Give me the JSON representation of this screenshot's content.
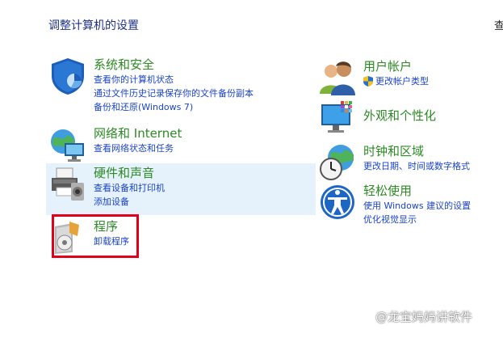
{
  "page": {
    "title": "调整计算机的设置",
    "view_by_label": "查"
  },
  "categories_left": [
    {
      "title": "系统和安全",
      "links": [
        "查看你的计算机状态",
        "通过文件历史记录保存你的文件备份副本",
        "备份和还原(Windows 7)"
      ]
    },
    {
      "title": "网络和 Internet",
      "links": [
        "查看网络状态和任务"
      ]
    },
    {
      "title": "硬件和声音",
      "links": [
        "查看设备和打印机",
        "添加设备"
      ]
    },
    {
      "title": "程序",
      "links": [
        "卸载程序"
      ]
    }
  ],
  "categories_right": [
    {
      "title": "用户帐户",
      "links": [
        "更改帐户类型"
      ]
    },
    {
      "title": "外观和个性化",
      "links": []
    },
    {
      "title": "时钟和区域",
      "links": [
        "更改日期、时间或数字格式"
      ]
    },
    {
      "title": "轻松使用",
      "links": [
        "使用 Windows 建议的设置",
        "优化视觉显示"
      ]
    }
  ],
  "watermark": {
    "text": "@龙宝妈妈讲软件"
  },
  "colors": {
    "category_title": "#2c8a24",
    "link": "#1a44c8",
    "page_title": "#1e3287",
    "highlight_bg": "#e5f1fb",
    "annotation_border": "#e1001a"
  }
}
